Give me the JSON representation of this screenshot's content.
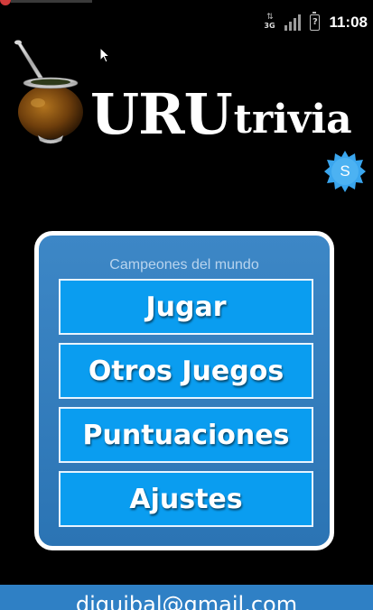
{
  "status_bar": {
    "network_type": "3G",
    "network_icon": "3g-data-icon",
    "signal_icon": "cell-signal-icon",
    "battery_icon": "battery-unknown-icon",
    "battery_symbol": "?",
    "time": "11:08"
  },
  "logo": {
    "mate_icon": "mate-gourd-icon",
    "uru": "URU",
    "trivia": "trivia"
  },
  "badge": {
    "icon": "star-badge-icon",
    "letter": "S",
    "color": "#3aa6ee"
  },
  "menu": {
    "subtitle": "Campeones del mundo",
    "buttons": [
      {
        "label": "Jugar"
      },
      {
        "label": "Otros Juegos"
      },
      {
        "label": "Puntuaciones"
      },
      {
        "label": "Ajustes"
      }
    ],
    "panel_color": "#3a84c4",
    "button_color": "#0a9df0"
  },
  "footer": {
    "email": "diguibal@gmail.com",
    "color": "#2f80c5"
  }
}
